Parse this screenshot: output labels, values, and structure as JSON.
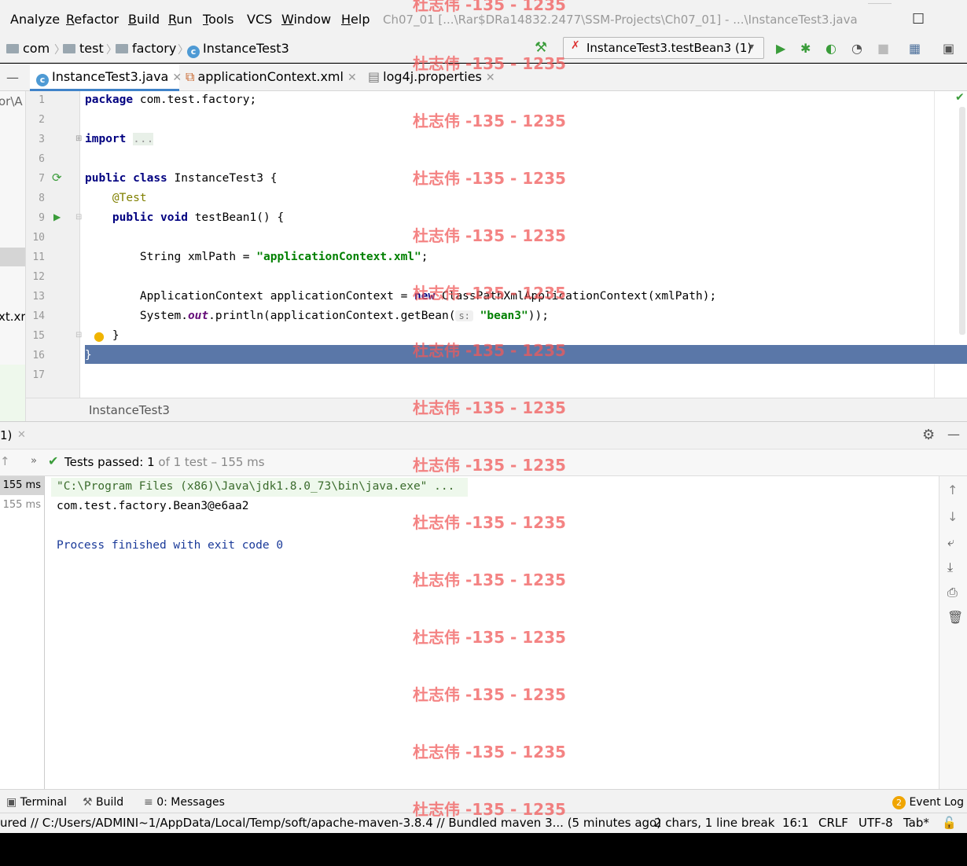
{
  "menu": {
    "items": [
      "Analyze",
      "Refactor",
      "Build",
      "Run",
      "Tools",
      "VCS",
      "Window",
      "Help"
    ],
    "mnemonics": [
      "",
      "R",
      "B",
      "R",
      "T",
      "",
      "W",
      "H"
    ]
  },
  "window_title": "Ch07_01 [...\\Rar$DRa14832.2477\\SSM-Projects\\Ch07_01] - ...\\InstanceTest3.java",
  "breadcrumb": [
    "com",
    "test",
    "factory",
    "InstanceTest3"
  ],
  "run_config": "InstanceTest3.testBean3 (1)",
  "tabs": [
    {
      "label": "InstanceTest3.java",
      "active": true
    },
    {
      "label": "applicationContext.xml",
      "active": false
    },
    {
      "label": "log4j.properties",
      "active": false
    }
  ],
  "project_strip": {
    "t1": "or\\A",
    "t2": "xt.xr"
  },
  "editor": {
    "line_numbers": [
      "1",
      "2",
      "3",
      "6",
      "7",
      "8",
      "9",
      "10",
      "11",
      "12",
      "13",
      "14",
      "15",
      "16",
      "17"
    ],
    "lines": {
      "l1_kw": "package",
      "l1_rest": " com.test.factory;",
      "l3_kw": "import",
      "l3_fold": "...",
      "l7_kw1": "public",
      "l7_kw2": "class",
      "l7_rest": " InstanceTest3 {",
      "l8_ann": "@Test",
      "l9_kw1": "public",
      "l9_kw2": "void",
      "l9_rest": " testBean1() {",
      "l11_a": "String xmlPath = ",
      "l11_str": "\"applicationContext.xml\"",
      "l11_b": ";",
      "l13_a": "ApplicationContext applicationContext = ",
      "l13_kw": "new",
      "l13_b": " ClassPathXmlApplicationContext(xmlPath);",
      "l14_a": "System.",
      "l14_fld": "out",
      "l14_b": ".println(applicationContext.getBean(",
      "l14_hint": "s:",
      "l14_str": "\"bean3\"",
      "l14_c": "));",
      "l15": "}",
      "l16": "}"
    },
    "footer": "InstanceTest3"
  },
  "run_panel": {
    "tab_label": "1)",
    "status_label": "Tests passed:",
    "status_count": "1",
    "status_rest": "of 1 test – 155 ms",
    "tree_times": [
      ": 155 ms",
      "155 ms"
    ],
    "console": [
      "\"C:\\Program Files (x86)\\Java\\jdk1.8.0_73\\bin\\java.exe\" ...",
      "com.test.factory.Bean3@e6aa2",
      "Process finished with exit code 0"
    ]
  },
  "tool_windows": {
    "terminal": "Terminal",
    "build": "Build",
    "messages": "0: Messages",
    "event_badge": "2",
    "event_log": "Event Log"
  },
  "status_bar": {
    "message": "ured // C:/Users/ADMINI~1/AppData/Local/Temp/soft/apache-maven-3.8.4 // Bundled maven 3... (5 minutes ago)",
    "selection": "2 chars, 1 line break",
    "position": "16:1",
    "line_sep": "CRLF",
    "encoding": "UTF-8",
    "indent": "Tab*"
  },
  "watermark": "杜志伟 -135 - 1235",
  "colors": {
    "highlight": "#5a77a8",
    "run_green": "#3a9c3a",
    "keyword": "#000080",
    "string": "#008000"
  }
}
